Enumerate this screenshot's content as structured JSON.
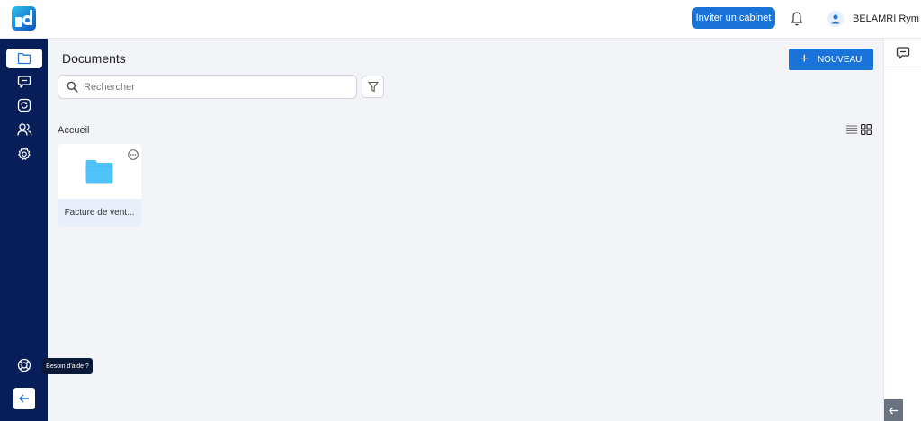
{
  "header": {
    "invite_label": "Inviter un cabinet",
    "user_name": "BELAMRI Rym"
  },
  "sidebar": {
    "items": [
      {
        "icon": "folder-icon",
        "active": true
      },
      {
        "icon": "chat-icon",
        "active": false
      },
      {
        "icon": "sync-icon",
        "active": false
      },
      {
        "icon": "users-icon",
        "active": false
      },
      {
        "icon": "gear-icon",
        "active": false
      }
    ],
    "help_tooltip": "Besoin d'aide ?",
    "help_icon": "lifebuoy-icon",
    "collapse_icon": "arrow-left-icon"
  },
  "main": {
    "title": "Documents",
    "new_label": "NOUVEAU",
    "search_placeholder": "Rechercher",
    "breadcrumb": "Accueil",
    "items": [
      {
        "type": "folder",
        "name": "Facture de vent..."
      }
    ]
  },
  "colors": {
    "accent": "#1a73d9",
    "sidebar": "#071e58",
    "folder": "#4fc3f7"
  }
}
